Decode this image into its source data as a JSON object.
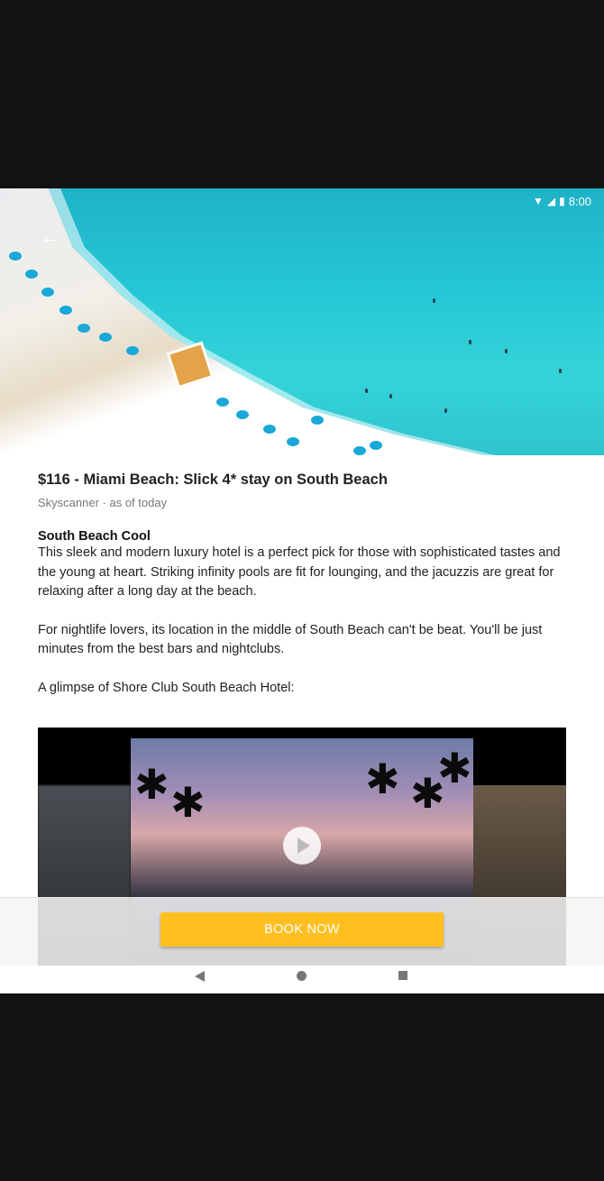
{
  "status_bar": {
    "time": "8:00"
  },
  "article": {
    "title": "$116 - Miami Beach: Slick 4* stay on South Beach",
    "meta": "Skyscanner · as of today",
    "section_title": "South Beach Cool",
    "paragraph1": "This sleek and modern luxury hotel is a perfect pick for those with sophisticated tastes and the young at heart. Striking infinity pools are fit for lounging, and the jacuzzis are great for relaxing after a long day at the beach.",
    "paragraph2": "For nightlife lovers, its location in the middle of South Beach can't be beat. You'll be just minutes from the best bars and nightclubs.",
    "paragraph3": "A glimpse of Shore Club South Beach Hotel:"
  },
  "cta": {
    "book_label": "BOOK NOW"
  },
  "icons": {
    "back": "arrow-left-icon",
    "play": "play-icon",
    "wifi": "wifi-icon",
    "signal": "signal-icon",
    "battery": "battery-icon"
  },
  "colors": {
    "accent": "#ffbf1f"
  }
}
